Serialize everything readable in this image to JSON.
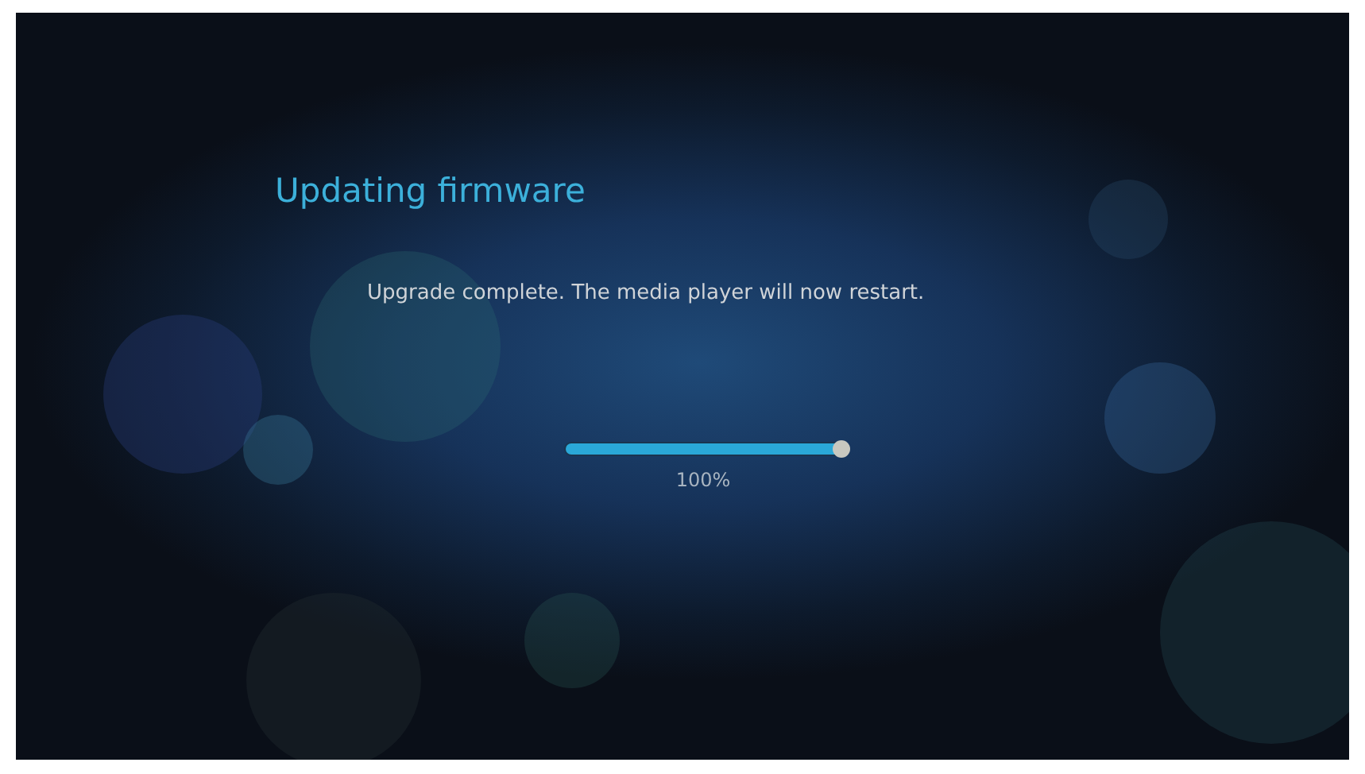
{
  "title": "Updating firmware",
  "message": "Upgrade complete. The media player will now restart.",
  "progress": {
    "level": 1.0,
    "reading": "100%"
  }
}
